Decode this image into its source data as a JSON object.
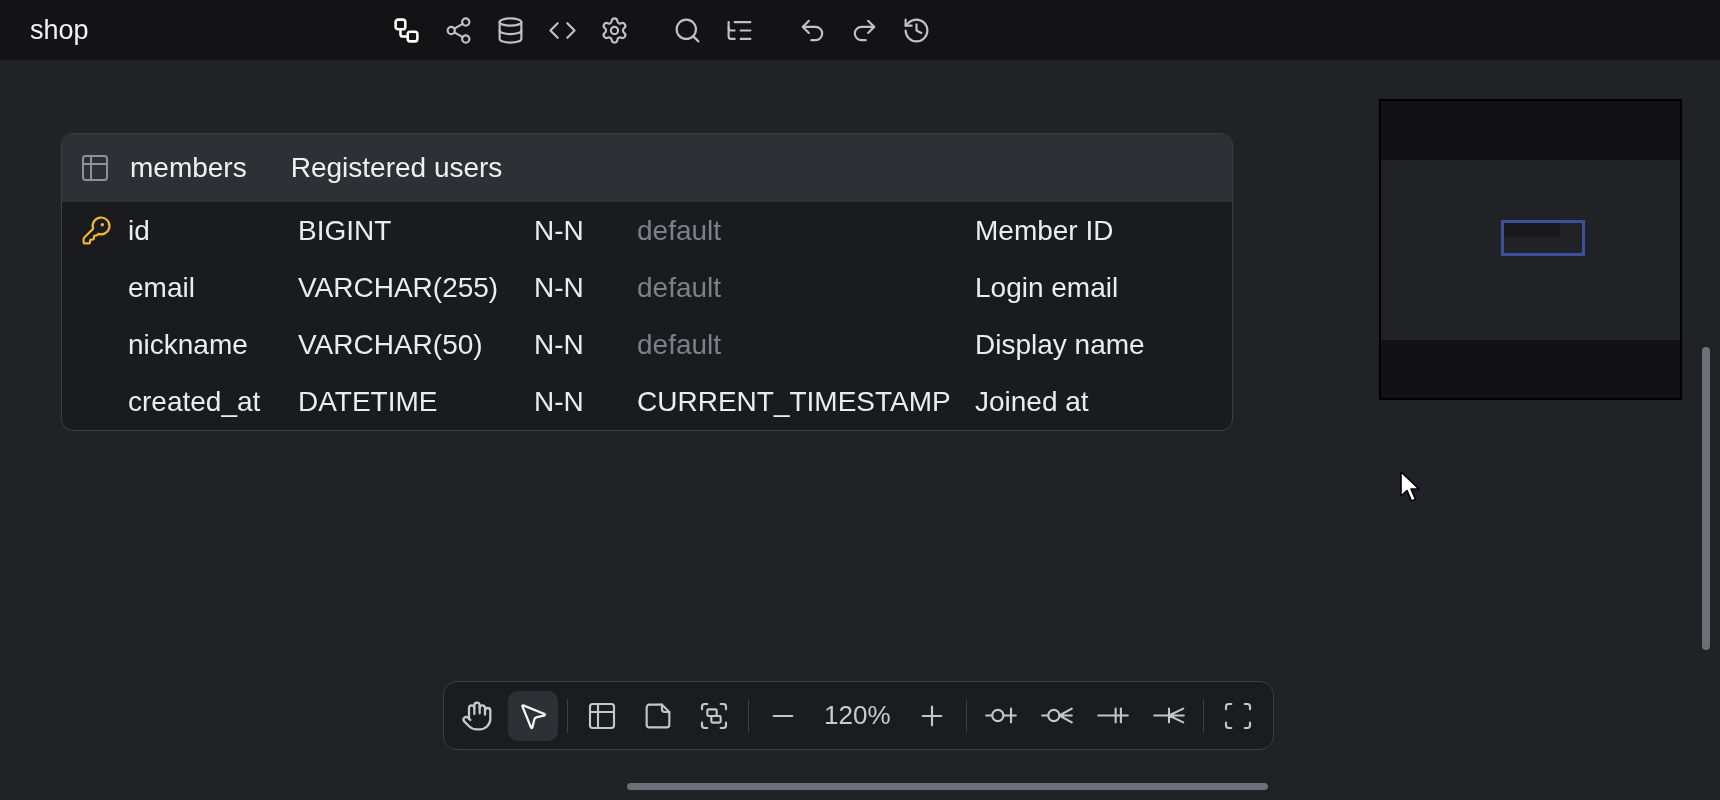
{
  "top_bar": {
    "title": "shop",
    "tool_groups": [
      [
        {
          "active": true
        },
        {
          "active": false
        },
        {
          "active": false
        },
        {
          "active": false
        },
        {
          "active": false
        }
      ],
      [
        {
          "active": false
        },
        {
          "active": false
        }
      ],
      [
        {
          "active": false
        },
        {
          "active": false
        },
        {
          "active": false
        }
      ]
    ]
  },
  "table": {
    "name": "members",
    "comment": "Registered users",
    "columns": [
      {
        "name": "id",
        "type": "BIGINT",
        "nullability": "N-N",
        "default": "default",
        "default_unset": true,
        "comment": "Member ID",
        "primary_key": true
      },
      {
        "name": "email",
        "type": "VARCHAR(255)",
        "nullability": "N-N",
        "default": "default",
        "default_unset": true,
        "comment": "Login email",
        "primary_key": false
      },
      {
        "name": "nickname",
        "type": "VARCHAR(50)",
        "nullability": "N-N",
        "default": "default",
        "default_unset": true,
        "comment": "Display name",
        "primary_key": false
      },
      {
        "name": "created_at",
        "type": "DATETIME",
        "nullability": "N-N",
        "default": "CURRENT_TIMESTAMP",
        "default_unset": false,
        "comment": "Joined at",
        "primary_key": false
      }
    ]
  },
  "bottom_toolbar": {
    "mode_tools": [
      {
        "selected": false
      },
      {
        "selected": true
      }
    ],
    "zoom": "120%"
  }
}
